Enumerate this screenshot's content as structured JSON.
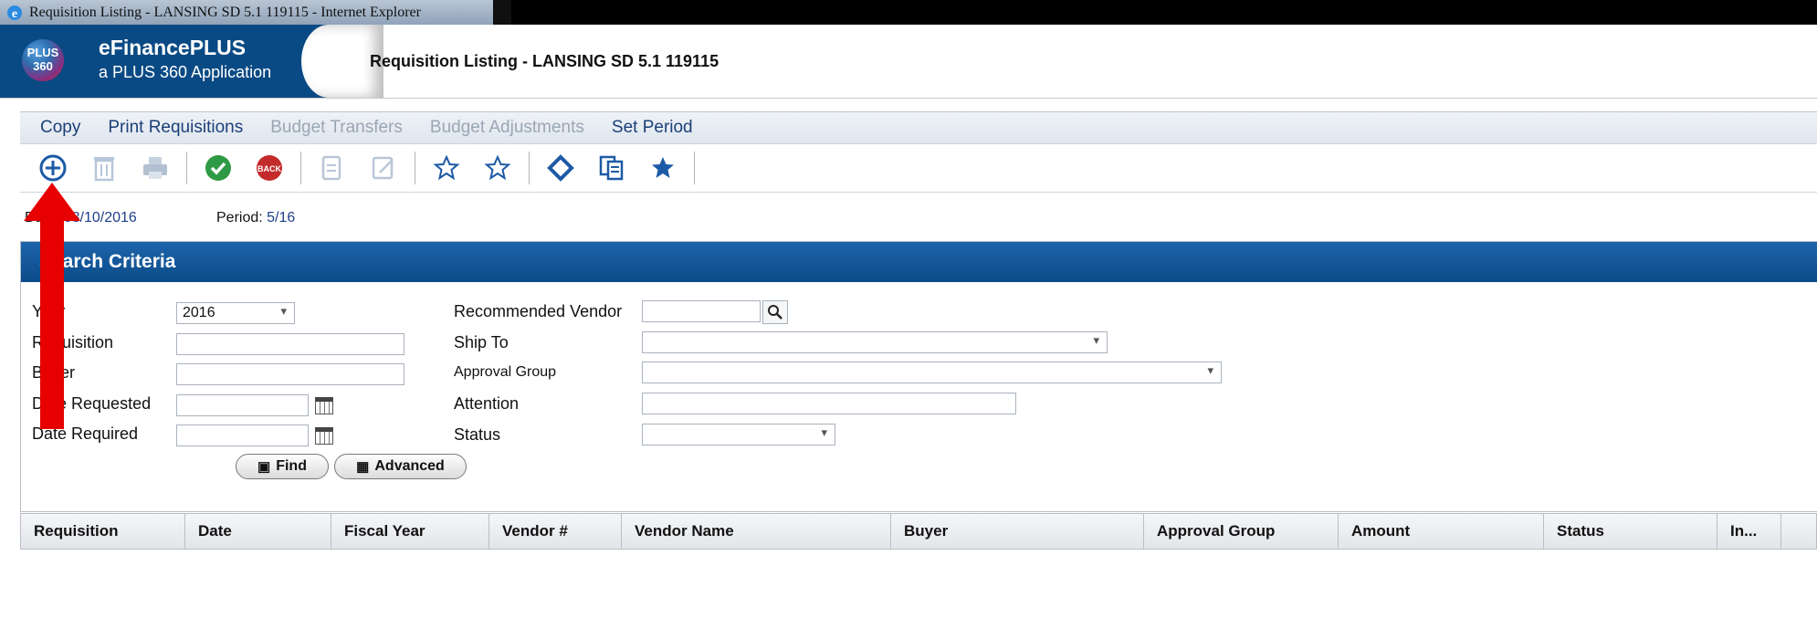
{
  "window": {
    "title": "Requisition Listing - LANSING SD 5.1 119115 - Internet Explorer"
  },
  "brand": {
    "logo_top": "PLUS",
    "logo_bottom": "360",
    "name": "eFinancePLUS",
    "tagline": "a PLUS 360 Application"
  },
  "page": {
    "title": "Requisition Listing - LANSING SD 5.1 119115"
  },
  "menu": {
    "items": [
      {
        "label": "Copy",
        "enabled": true
      },
      {
        "label": "Print Requisitions",
        "enabled": true
      },
      {
        "label": "Budget Transfers",
        "enabled": false
      },
      {
        "label": "Budget Adjustments",
        "enabled": false
      },
      {
        "label": "Set Period",
        "enabled": true
      }
    ]
  },
  "toolbar": {
    "icons": [
      "add-icon",
      "delete-icon",
      "print-icon",
      "ok-icon",
      "back-icon",
      "edit-doc-icon",
      "notes-icon",
      "star-outline-icon",
      "star-outline-2-icon",
      "diamond-icon",
      "copy-pages-icon",
      "star-filled-icon"
    ]
  },
  "info": {
    "date_label": "Date:",
    "date_value": "03/10/2016",
    "period_label": "Period:",
    "period_value": "5/16"
  },
  "search": {
    "heading": "Search Criteria",
    "year_label": "Year",
    "year_value": "2016",
    "requisition_label": "Requisition",
    "buyer_label": "Buyer",
    "date_requested_label": "Date Requested",
    "date_required_label": "Date Required",
    "vendor_label": "Recommended Vendor",
    "ship_to_label": "Ship To",
    "approval_group_label": "Approval Group",
    "attention_label": "Attention",
    "status_label": "Status",
    "find_label": "Find",
    "advanced_label": "Advanced"
  },
  "table": {
    "columns": [
      "Requisition",
      "Date",
      "Fiscal Year",
      "Vendor #",
      "Vendor Name",
      "Buyer",
      "Approval Group",
      "Amount",
      "Status",
      "In..."
    ],
    "rows": []
  },
  "colors": {
    "brand_blue": "#0a4a84",
    "panel_header": "#1e64aa",
    "annotation_arrow": "#e60000"
  }
}
